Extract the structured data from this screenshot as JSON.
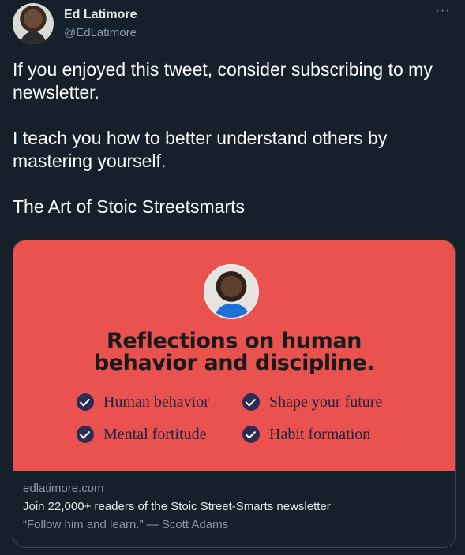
{
  "tweet": {
    "author_name": "Ed Latimore",
    "author_handle": "@EdLatimore",
    "more_icon": "···",
    "paragraphs": [
      "If you enjoyed this tweet, consider subscribing to my newsletter.",
      "I teach you how to better understand others by mastering yourself.",
      "The Art of Stoic Streetsmarts"
    ]
  },
  "card": {
    "headline_line1": "Reflections on human",
    "headline_line2": "behavior and discipline.",
    "features": [
      "Human behavior",
      "Shape your future",
      "Mental fortitude",
      "Habit formation"
    ],
    "domain": "edlatimore.com",
    "title": "Join 22,000+ readers of the Stoic Street-Smarts newsletter",
    "description": "“Follow him and learn.” — Scott Adams"
  },
  "colors": {
    "background": "#15202b",
    "card_accent": "#e9524e",
    "check_badge": "#2b2d55"
  }
}
